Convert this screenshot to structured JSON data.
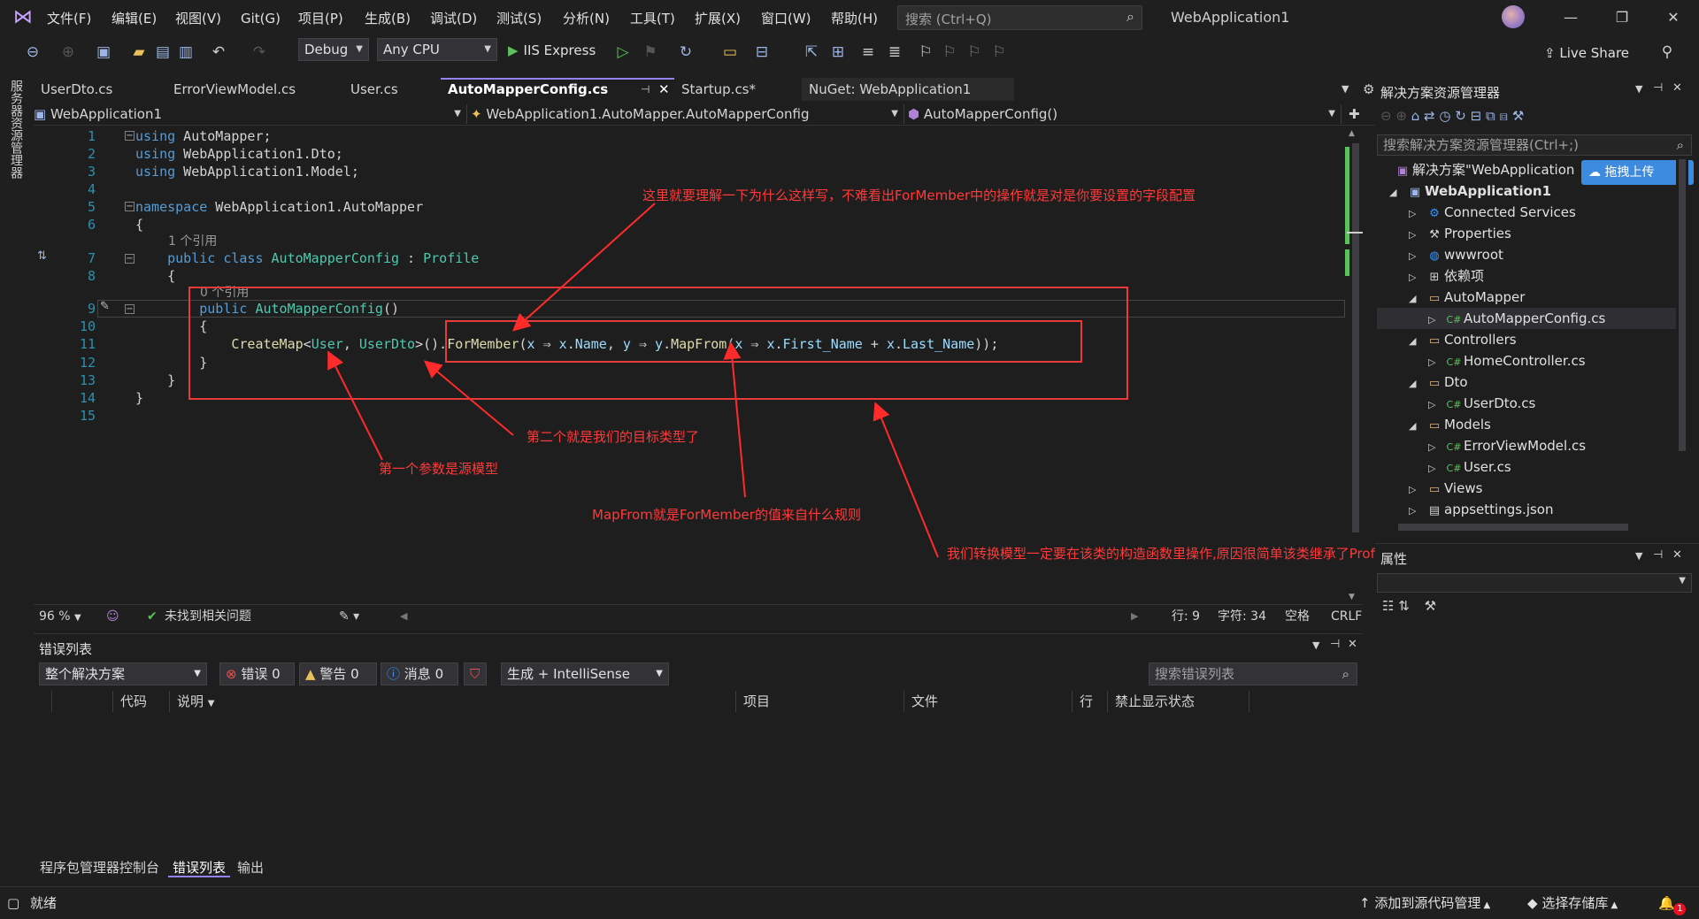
{
  "menu": [
    "文件(F)",
    "编辑(E)",
    "视图(V)",
    "Git(G)",
    "项目(P)",
    "生成(B)",
    "调试(D)",
    "测试(S)",
    "分析(N)",
    "工具(T)",
    "扩展(X)",
    "窗口(W)",
    "帮助(H)"
  ],
  "search": {
    "placeholder": "搜索 (Ctrl+Q)"
  },
  "window_title": "WebApplication1",
  "toolbar": {
    "config": "Debug",
    "platform": "Any CPU",
    "run": "IIS Express",
    "live_share": "Live Share"
  },
  "left_strip_label": "服务器资源管理器",
  "doc_tabs": [
    "UserDto.cs",
    "ErrorViewModel.cs",
    "User.cs",
    "AutoMapperConfig.cs",
    "Startup.cs*",
    "NuGet: WebApplication1"
  ],
  "nav": {
    "project": "WebApplication1",
    "type": "WebApplication1.AutoMapper.AutoMapperConfig",
    "member": "AutoMapperConfig()"
  },
  "code": {
    "line_numbers": [
      "1",
      "2",
      "3",
      "4",
      "5",
      "6",
      "7",
      "8",
      "9",
      "10",
      "11",
      "12",
      "13",
      "14",
      "15"
    ],
    "ref_hint_class": "1 个引用",
    "ref_hint_ctor": "0 个引用"
  },
  "annotations": {
    "top": "这里就要理解一下为什么这样写，不难看出ForMember中的操作就是对是你要设置的字段配置",
    "second": "第二个就是我们的目标类型了",
    "first": "第一个参数是源模型",
    "mapfrom": "MapFrom就是ForMember的值来自什么规则",
    "ctor": "我们转换模型一定要在该类的构造函数里操作,原因很简单该类继承了Profile"
  },
  "edit_status": {
    "zoom": "96 %",
    "issues": "未找到相关问题",
    "line": "行: 9",
    "char": "字符: 34",
    "space": "空格",
    "eol": "CRLF"
  },
  "error_list": {
    "title": "错误列表",
    "scope": "整个解决方案",
    "errors": "错误 0",
    "warnings": "警告 0",
    "messages": "消息 0",
    "build": "生成 + IntelliSense",
    "search_placeholder": "搜索错误列表",
    "columns": [
      "代码",
      "说明",
      "项目",
      "文件",
      "行",
      "禁止显示状态"
    ]
  },
  "bottom_tabs": [
    "程序包管理器控制台",
    "错误列表",
    "输出"
  ],
  "solution": {
    "title": "解决方案资源管理器",
    "search_placeholder": "搜索解决方案资源管理器(Ctrl+;)",
    "root": "解决方案\"WebApplication",
    "upload": "拖拽上传",
    "items": [
      "WebApplication1",
      "Connected Services",
      "Properties",
      "wwwroot",
      "依赖项",
      "AutoMapper",
      "AutoMapperConfig.cs",
      "Controllers",
      "HomeController.cs",
      "Dto",
      "UserDto.cs",
      "Models",
      "ErrorViewModel.cs",
      "User.cs",
      "Views",
      "appsettings.json"
    ]
  },
  "properties": {
    "title": "属性"
  },
  "statusbar": {
    "ready": "就绪",
    "add_source": "添加到源代码管理",
    "select_repo": "选择存储库",
    "notif_count": "1"
  },
  "colors": {
    "accent": "#9184ee",
    "annotation": "#ff3a3a",
    "keyword": "#569cd6",
    "type": "#4ec9b0"
  }
}
